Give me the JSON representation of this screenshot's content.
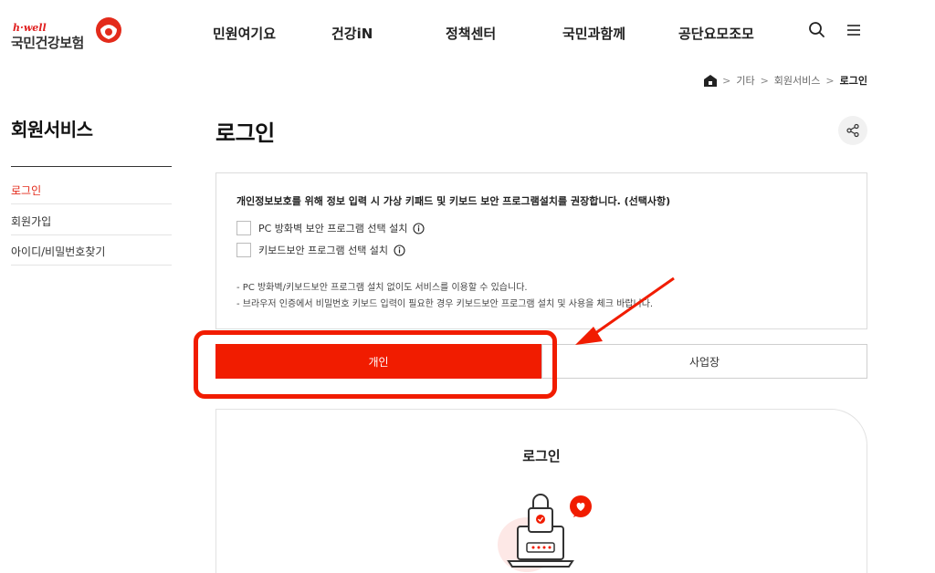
{
  "header": {
    "logo_hwell": "h·well",
    "logo_text": "국민건강보험",
    "nav": [
      "민원여기요",
      "건강iN",
      "정책센터",
      "국민과함께",
      "공단요모조모"
    ],
    "icons": [
      "search-icon",
      "menu-icon"
    ]
  },
  "breadcrumb": {
    "home_icon": "home-icon",
    "items": [
      "기타",
      "회원서비스",
      "로그인"
    ]
  },
  "sidebar": {
    "title": "회원서비스",
    "items": [
      {
        "label": "로그인",
        "active": true
      },
      {
        "label": "회원가입",
        "active": false
      },
      {
        "label": "아이디/비밀번호찾기",
        "active": false
      }
    ]
  },
  "main": {
    "title": "로그인",
    "share_icon": "share-icon",
    "security": {
      "title": "개인정보보호를 위해 정보 입력 시 가상 키패드 및 키보드 보안 프로그램설치를 권장합니다. (선택사항)",
      "options": [
        {
          "label": "PC 방화벽 보안 프로그램 선택 설치",
          "checked": false
        },
        {
          "label": "키보드보안 프로그램 선택 설치",
          "checked": false
        }
      ],
      "notes": [
        "- PC 방화벽/키보드보안 프로그램 설치 없이도 서비스를 이용할 수 있습니다.",
        "- 브라우저 인증에서 비밀번호 키보드 입력이 필요한 경우 키보드보안 프로그램 설치 및 사용을 체크 바랍니다."
      ]
    },
    "tabs": [
      {
        "label": "개인",
        "active": true
      },
      {
        "label": "사업장",
        "active": false
      }
    ],
    "login_card": {
      "title": "로그인",
      "illustration": "laptop-lock-icon"
    }
  },
  "colors": {
    "accent": "#f11c00",
    "active_link": "#e32b1b"
  }
}
